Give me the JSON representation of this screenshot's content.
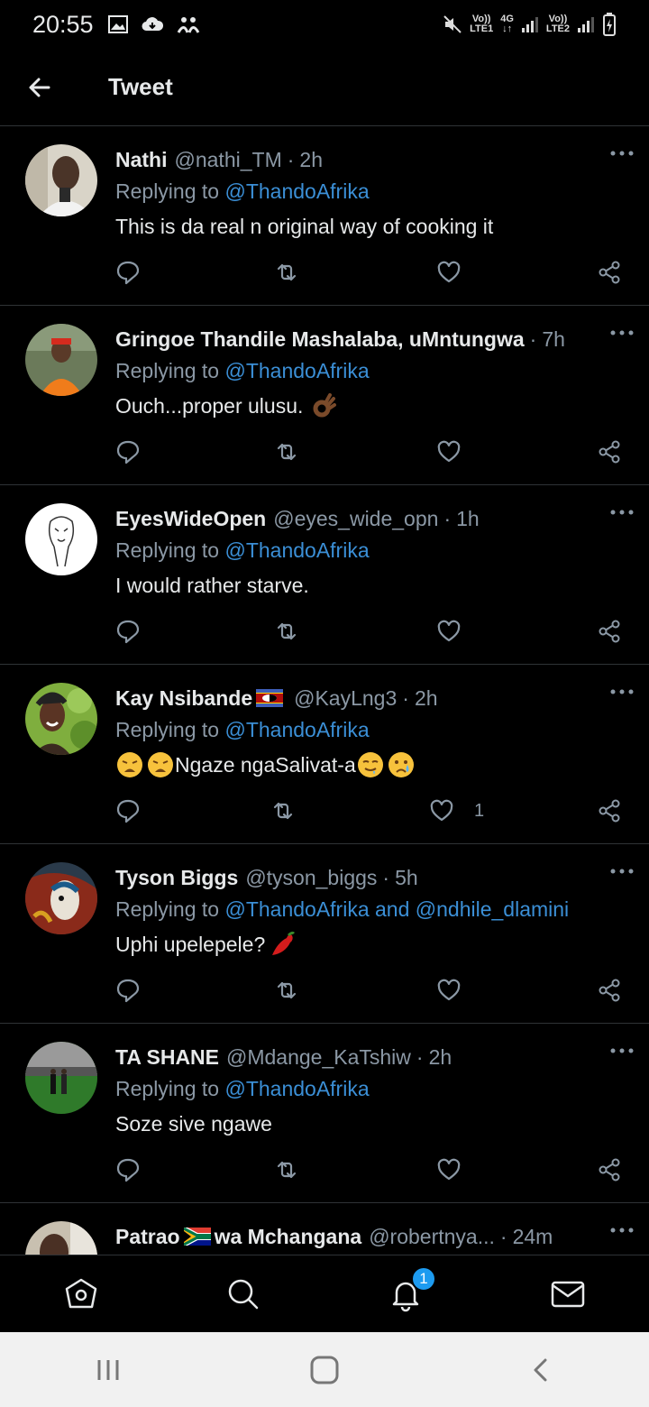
{
  "status_bar": {
    "time": "20:55",
    "net1_top": "Vo))",
    "net1_bottom": "LTE1",
    "net_type": "4G",
    "net2_top": "Vo))",
    "net2_bottom": "LTE2",
    "icons": [
      "image-icon",
      "cloud-icon",
      "people-icon",
      "mute-icon",
      "signal-icon",
      "battery-charging-icon"
    ]
  },
  "header": {
    "title": "Tweet",
    "back_icon": "arrow-left-icon"
  },
  "colors": {
    "background": "#000000",
    "text": "#e7e9ea",
    "secondary": "#8b98a5",
    "accent": "#3b8fd6",
    "badge": "#1d9bf0",
    "divider": "#2f3336"
  },
  "tweets": [
    {
      "name": "Nathi",
      "handle": "@nathi_TM",
      "time": "2h",
      "replying_prefix": "Replying to ",
      "mentions": "@ThandoAfrika",
      "text": "This is da real n original way of cooking it",
      "like_count": ""
    },
    {
      "name": "Gringoe Thandile Mashalaba, uMntungwa",
      "handle": "",
      "time": "7h",
      "replying_prefix": "Replying to ",
      "mentions": "@ThandoAfrika",
      "text": "Ouch...proper ulusu.",
      "emoji_after": "ok-hand",
      "like_count": ""
    },
    {
      "name": "EyesWideOpen",
      "handle": "@eyes_wide_opn",
      "time": "1h",
      "replying_prefix": "Replying to ",
      "mentions": "@ThandoAfrika",
      "text": "I would rather starve.",
      "like_count": ""
    },
    {
      "name": "Kay Nsibande",
      "handle": "@KayLng3",
      "time": "2h",
      "replying_prefix": "Replying to ",
      "mentions": "@ThandoAfrika",
      "text": "Ngaze ngaSalivat-a",
      "like_count": "1"
    },
    {
      "name": "Tyson Biggs",
      "handle": "@tyson_biggs",
      "time": "5h",
      "replying_prefix": "Replying to ",
      "mentions": "@ThandoAfrika and @ndhile_dlamini",
      "text": "Uphi upelepele?",
      "like_count": ""
    },
    {
      "name": "TA SHANE",
      "handle": "@Mdange_KaTshiw",
      "time": "2h",
      "replying_prefix": "Replying to ",
      "mentions": "@ThandoAfrika",
      "text": "Soze sive ngawe",
      "like_count": ""
    },
    {
      "name_a": "Patrao",
      "name_b": "wa Mchangana",
      "handle": "@robertnya...",
      "time": "24m"
    }
  ],
  "bottom_nav": {
    "items": [
      "home-icon",
      "search-icon",
      "notifications-icon",
      "messages-icon"
    ],
    "notification_badge": "1"
  },
  "system_nav": {
    "items": [
      "recents-icon",
      "home-button-icon",
      "back-icon"
    ]
  }
}
